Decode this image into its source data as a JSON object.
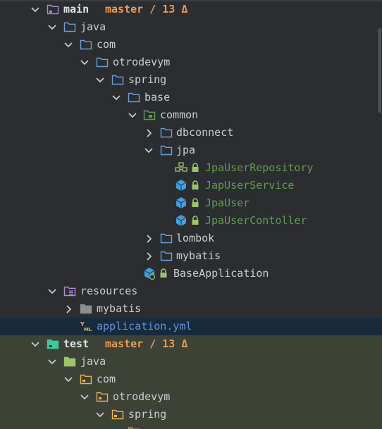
{
  "tree": {
    "main": {
      "label": "main",
      "branch": "master / 13 Δ"
    },
    "java": "java",
    "com": "com",
    "otrodevym": "otrodevym",
    "spring": "spring",
    "base": "base",
    "common": "common",
    "dbconnect": "dbconnect",
    "jpa": "jpa",
    "jpa_items": [
      "JpaUserRepository",
      "JapUserService",
      "JpaUser",
      "JpaUserContoller"
    ],
    "lombok": "lombok",
    "mybatis": "mybatis",
    "base_application": "BaseApplication",
    "resources": "resources",
    "res_mybatis": "mybatis",
    "application_yml": "application.yml",
    "test": {
      "label": "test",
      "branch": "master / 13 Δ"
    },
    "test_java": "java",
    "test_com": "com",
    "test_otrodevym": "otrodevym",
    "test_spring": "spring"
  },
  "colors": {
    "background": "#2b2d30",
    "selected_row": "#172b3d",
    "test_row": "#3c4236",
    "branch": "#e89a5b",
    "vcs_added": "#5f9c4f",
    "vcs_modified": "#5f92d6",
    "folder_blue": "#6a9edc",
    "folder_yellow": "#e6b450"
  },
  "icons": {
    "expanded": "chevron-down-icon",
    "collapsed": "chevron-right-icon",
    "folder": "folder-icon",
    "package": "package-folder-icon",
    "module": "module-folder-icon",
    "resources": "resources-folder-icon",
    "interface": "interface-icon",
    "class": "class-icon",
    "lock": "lock-icon",
    "yaml": "yaml-file-icon"
  }
}
